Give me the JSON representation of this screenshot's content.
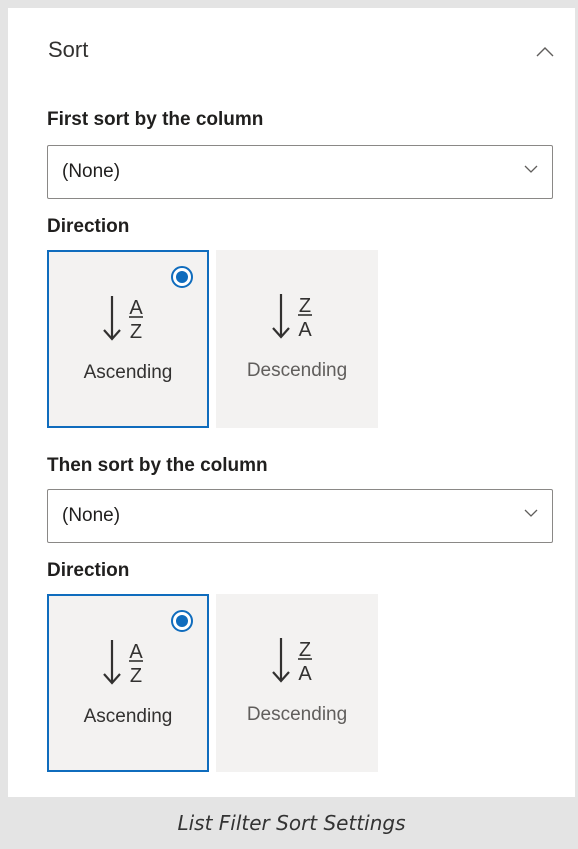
{
  "panel": {
    "title": "Sort",
    "first_sort": {
      "label": "First sort by the column",
      "selected_value": "(None)",
      "direction_label": "Direction",
      "options": [
        {
          "label": "Ascending",
          "selected": true,
          "icon": "sort-ascending-icon",
          "glyph_top": "A",
          "glyph_bottom": "Z"
        },
        {
          "label": "Descending",
          "selected": false,
          "icon": "sort-descending-icon",
          "glyph_top": "Z",
          "glyph_bottom": "A"
        }
      ]
    },
    "then_sort": {
      "label": "Then sort by the column",
      "selected_value": "(None)",
      "direction_label": "Direction",
      "options": [
        {
          "label": "Ascending",
          "selected": true,
          "icon": "sort-ascending-icon",
          "glyph_top": "A",
          "glyph_bottom": "Z"
        },
        {
          "label": "Descending",
          "selected": false,
          "icon": "sort-descending-icon",
          "glyph_top": "Z",
          "glyph_bottom": "A"
        }
      ]
    }
  },
  "caption": "List Filter Sort Settings",
  "colors": {
    "accent": "#0f6cbd",
    "option_background": "#f3f2f1",
    "caption_bar": "#e4e4e4"
  }
}
